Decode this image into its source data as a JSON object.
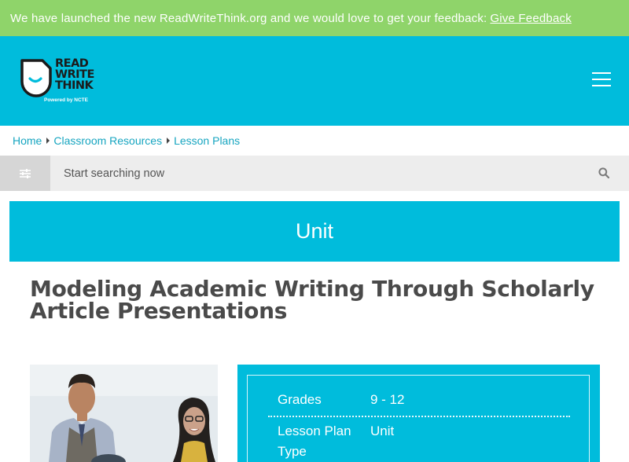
{
  "banner": {
    "message": "We have launched the new ReadWriteThink.org and we would love to get your feedback:",
    "link_label": "Give Feedback"
  },
  "header": {
    "logo_line1": "READ",
    "logo_line2": "WRITE",
    "logo_line3": "THINK",
    "logo_tagline": "Powered by NCTE",
    "menu_icon": "hamburger-menu-icon"
  },
  "breadcrumb": {
    "items": [
      "Home",
      "Classroom Resources",
      "Lesson Plans"
    ]
  },
  "search": {
    "placeholder": "Start searching now",
    "filter_icon": "sliders-icon",
    "search_icon": "magnifier-icon"
  },
  "resource_type": "Unit",
  "title": "Modeling Academic Writing Through Scholarly Article Presentations",
  "details": {
    "grades_label": "Grades",
    "grades_value": "9 - 12",
    "type_label": "Lesson Plan Type",
    "type_value": "Unit"
  },
  "colors": {
    "banner": "#8fd46a",
    "brand": "#00bcdc",
    "link": "#16a5c0",
    "title": "#4a4a4a"
  }
}
